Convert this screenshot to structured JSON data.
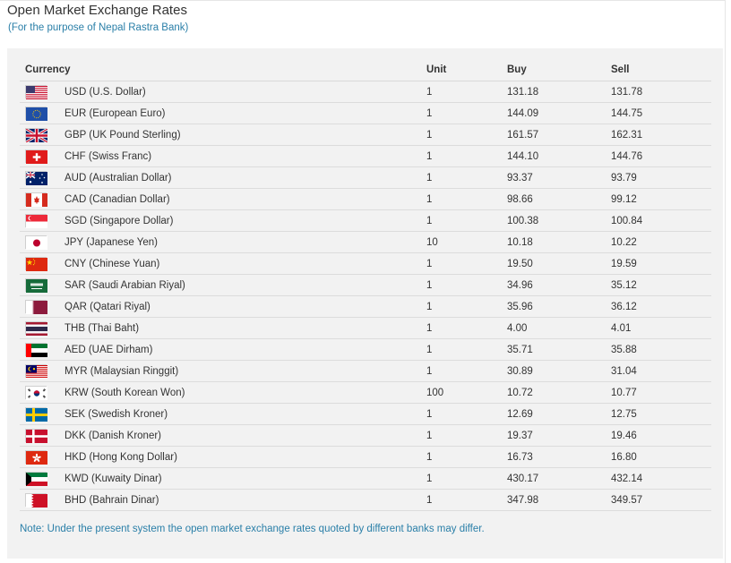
{
  "header": {
    "title": "Open Market Exchange Rates",
    "subtitle": "(For the purpose of Nepal Rastra Bank)"
  },
  "table": {
    "columns": {
      "currency": "Currency",
      "unit": "Unit",
      "buy": "Buy",
      "sell": "Sell"
    },
    "rows": [
      {
        "flag": "us-flag-icon",
        "currency": "USD (U.S. Dollar)",
        "unit": "1",
        "buy": "131.18",
        "sell": "131.78"
      },
      {
        "flag": "eu-flag-icon",
        "currency": "EUR (European Euro)",
        "unit": "1",
        "buy": "144.09",
        "sell": "144.75"
      },
      {
        "flag": "gb-flag-icon",
        "currency": "GBP (UK Pound Sterling)",
        "unit": "1",
        "buy": "161.57",
        "sell": "162.31"
      },
      {
        "flag": "ch-flag-icon",
        "currency": "CHF (Swiss Franc)",
        "unit": "1",
        "buy": "144.10",
        "sell": "144.76"
      },
      {
        "flag": "au-flag-icon",
        "currency": "AUD (Australian Dollar)",
        "unit": "1",
        "buy": "93.37",
        "sell": "93.79"
      },
      {
        "flag": "ca-flag-icon",
        "currency": "CAD (Canadian Dollar)",
        "unit": "1",
        "buy": "98.66",
        "sell": "99.12"
      },
      {
        "flag": "sg-flag-icon",
        "currency": "SGD (Singapore Dollar)",
        "unit": "1",
        "buy": "100.38",
        "sell": "100.84"
      },
      {
        "flag": "jp-flag-icon",
        "currency": "JPY (Japanese Yen)",
        "unit": "10",
        "buy": "10.18",
        "sell": "10.22"
      },
      {
        "flag": "cn-flag-icon",
        "currency": "CNY (Chinese Yuan)",
        "unit": "1",
        "buy": "19.50",
        "sell": "19.59"
      },
      {
        "flag": "sa-flag-icon",
        "currency": "SAR (Saudi Arabian Riyal)",
        "unit": "1",
        "buy": "34.96",
        "sell": "35.12"
      },
      {
        "flag": "qa-flag-icon",
        "currency": "QAR (Qatari Riyal)",
        "unit": "1",
        "buy": "35.96",
        "sell": "36.12"
      },
      {
        "flag": "th-flag-icon",
        "currency": "THB (Thai Baht)",
        "unit": "1",
        "buy": "4.00",
        "sell": "4.01"
      },
      {
        "flag": "ae-flag-icon",
        "currency": "AED (UAE Dirham)",
        "unit": "1",
        "buy": "35.71",
        "sell": "35.88"
      },
      {
        "flag": "my-flag-icon",
        "currency": "MYR (Malaysian Ringgit)",
        "unit": "1",
        "buy": "30.89",
        "sell": "31.04"
      },
      {
        "flag": "kr-flag-icon",
        "currency": "KRW (South Korean Won)",
        "unit": "100",
        "buy": "10.72",
        "sell": "10.77"
      },
      {
        "flag": "se-flag-icon",
        "currency": "SEK (Swedish Kroner)",
        "unit": "1",
        "buy": "12.69",
        "sell": "12.75"
      },
      {
        "flag": "dk-flag-icon",
        "currency": "DKK (Danish Kroner)",
        "unit": "1",
        "buy": "19.37",
        "sell": "19.46"
      },
      {
        "flag": "hk-flag-icon",
        "currency": "HKD (Hong Kong Dollar)",
        "unit": "1",
        "buy": "16.73",
        "sell": "16.80"
      },
      {
        "flag": "kw-flag-icon",
        "currency": "KWD (Kuwaity Dinar)",
        "unit": "1",
        "buy": "430.17",
        "sell": "432.14"
      },
      {
        "flag": "bh-flag-icon",
        "currency": "BHD (Bahrain Dinar)",
        "unit": "1",
        "buy": "347.98",
        "sell": "349.57"
      }
    ]
  },
  "note": "Note: Under the present system the open market exchange rates quoted by different banks may differ.",
  "colors": {
    "accent": "#2a7fa8",
    "panel": "#f2f2f2"
  }
}
